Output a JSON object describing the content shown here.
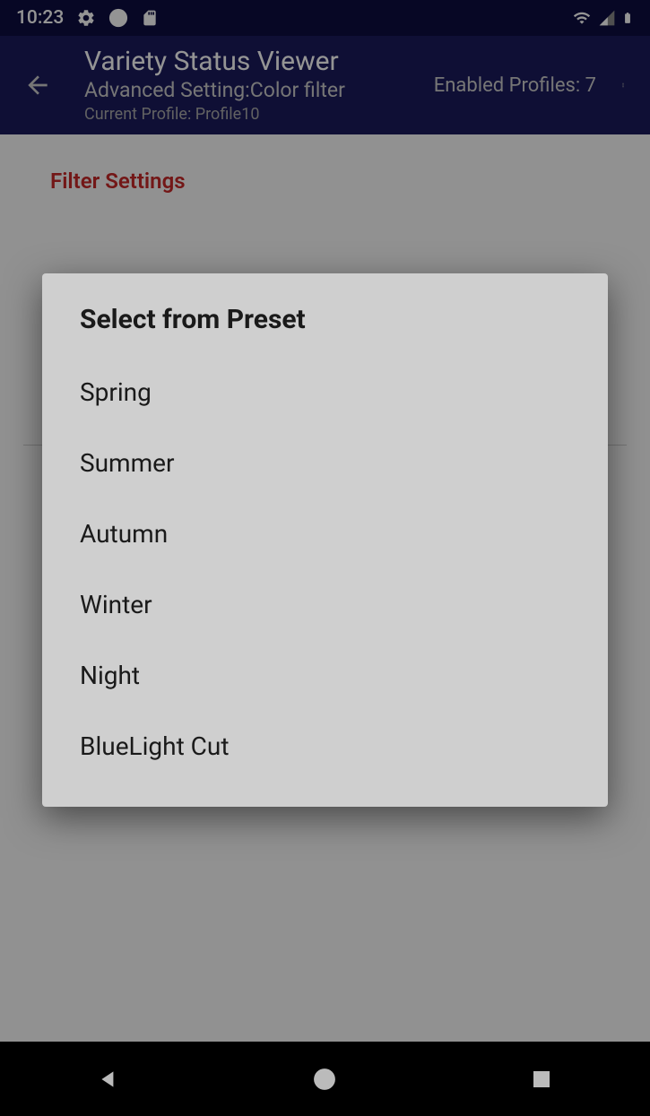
{
  "statusBar": {
    "time": "10:23"
  },
  "appBar": {
    "title": "Variety Status Viewer",
    "subtitle": "Advanced Setting:Color filter",
    "profile": "Current Profile: Profile10",
    "enabledProfiles": "Enabled Profiles: 7"
  },
  "content": {
    "sectionHeader": "Filter Settings"
  },
  "dialog": {
    "title": "Select from Preset",
    "options": [
      "Spring",
      "Summer",
      "Autumn",
      "Winter",
      "Night",
      "BlueLight Cut"
    ]
  }
}
